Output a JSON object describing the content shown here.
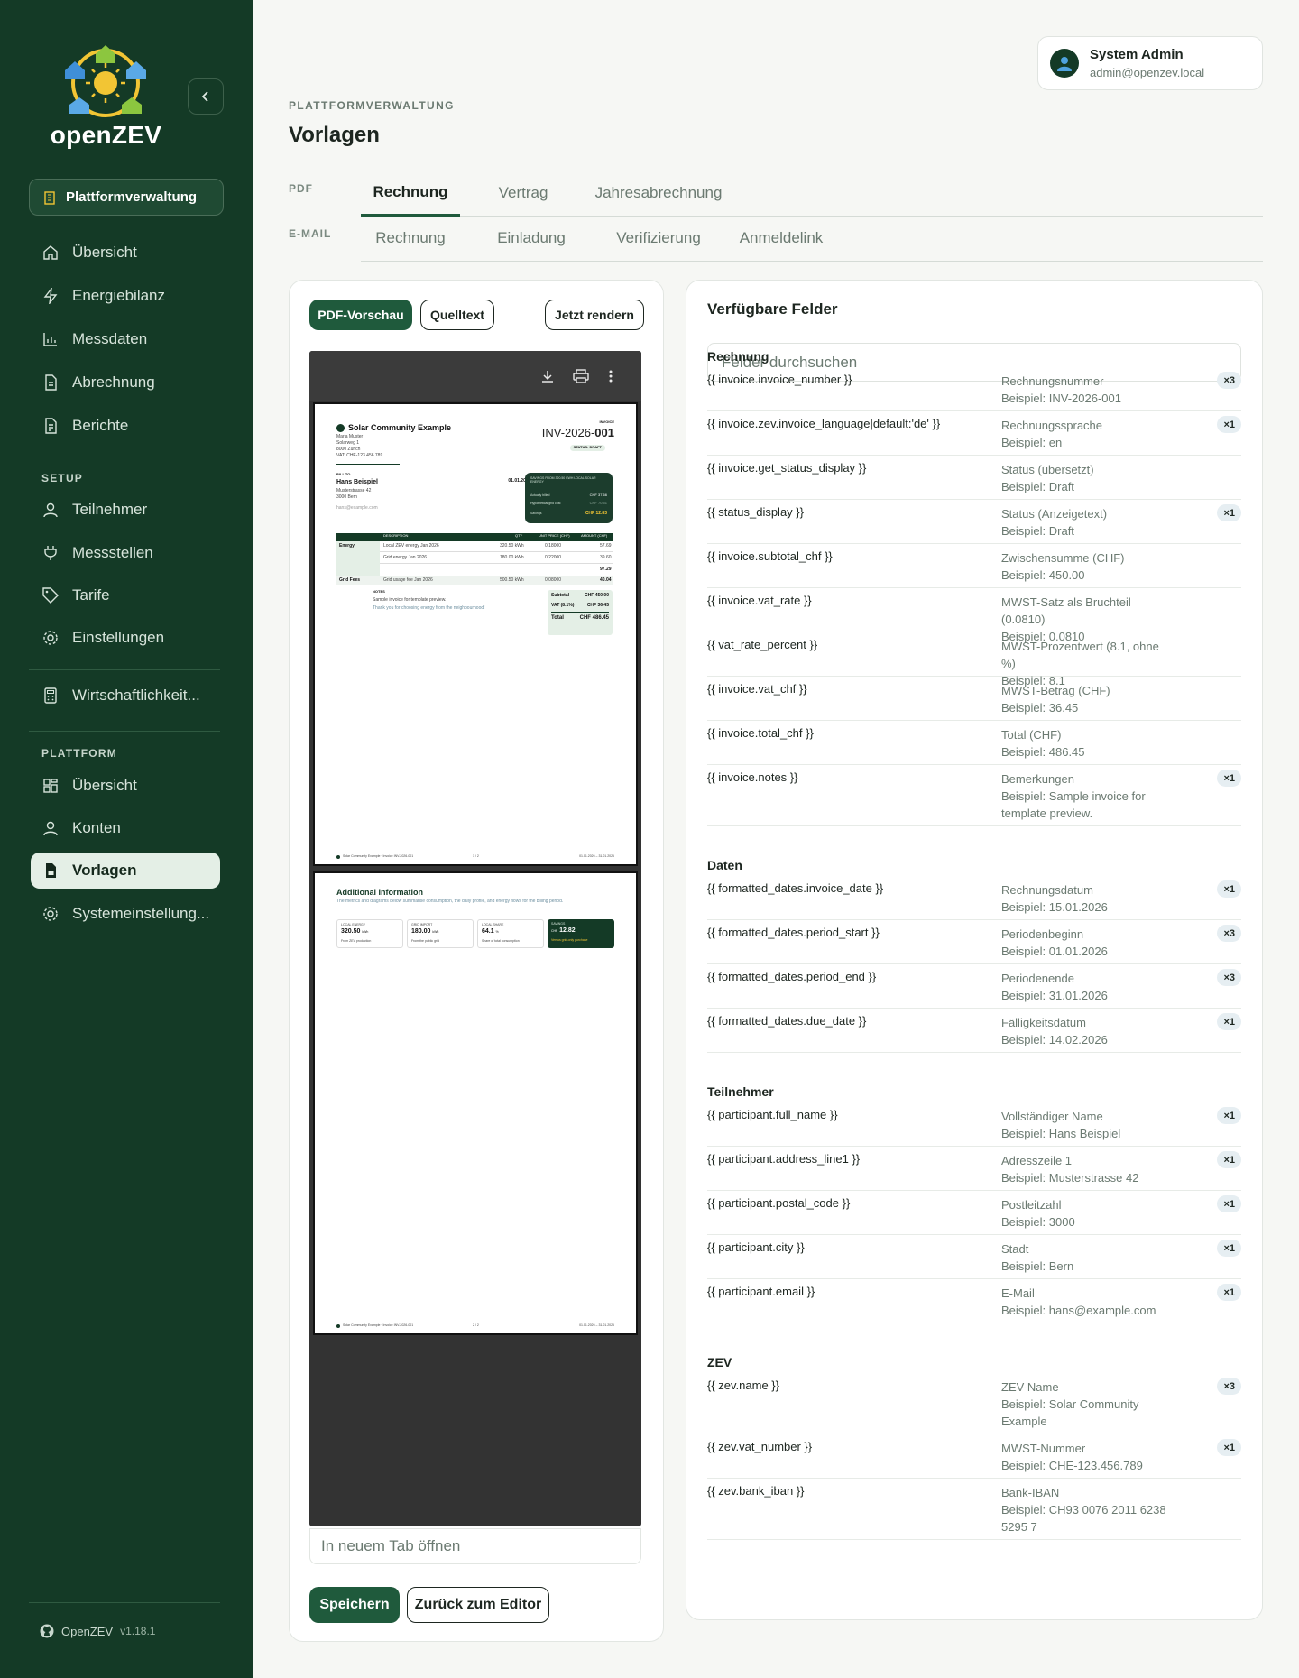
{
  "brand": {
    "name": "openZEV",
    "version_label": "OpenZEV",
    "version": "v1.18.1"
  },
  "sidebar": {
    "platform_button": "Plattformverwaltung",
    "main_items": [
      {
        "label": "Übersicht",
        "icon": "home-icon"
      },
      {
        "label": "Energiebilanz",
        "icon": "bolt-icon"
      },
      {
        "label": "Messdaten",
        "icon": "bar-chart-icon"
      },
      {
        "label": "Abrechnung",
        "icon": "document-icon"
      },
      {
        "label": "Berichte",
        "icon": "report-icon"
      }
    ],
    "setup_label": "SETUP",
    "setup_items": [
      {
        "label": "Teilnehmer",
        "icon": "user-icon"
      },
      {
        "label": "Messstellen",
        "icon": "plug-icon"
      },
      {
        "label": "Tarife",
        "icon": "tag-icon"
      },
      {
        "label": "Einstellungen",
        "icon": "gear-icon"
      }
    ],
    "extra_item": {
      "label": "Wirtschaftlichkeit...",
      "icon": "calculator-icon"
    },
    "platform_label": "PLATTFORM",
    "platform_items": [
      {
        "label": "Übersicht",
        "icon": "dashboard-icon"
      },
      {
        "label": "Konten",
        "icon": "user-icon"
      },
      {
        "label": "Vorlagen",
        "icon": "template-icon",
        "active": true
      },
      {
        "label": "Systemeinstellung...",
        "icon": "gear-icon"
      }
    ]
  },
  "user": {
    "name": "System Admin",
    "email": "admin@openzev.local"
  },
  "header": {
    "kicker": "PLATTFORMVERWALTUNG",
    "title": "Vorlagen"
  },
  "tabs": {
    "pdf_label": "PDF",
    "pdf": [
      "Rechnung",
      "Vertrag",
      "Jahresabrechnung"
    ],
    "email_label": "E-MAIL",
    "email": [
      "Rechnung",
      "Einladung",
      "Verifizierung",
      "Anmeldelink"
    ]
  },
  "preview": {
    "pdf_preview_btn": "PDF-Vorschau",
    "source_btn": "Quelltext",
    "render_btn": "Jetzt rendern",
    "open_new_tab": "In neuem Tab öffnen",
    "save_btn": "Speichern",
    "back_btn": "Zurück zum Editor",
    "doc": {
      "community": "Solar Community Example",
      "sender_lines": [
        "Maria Muster",
        "Solarweg 1",
        "8000 Zürich",
        "VAT: CHE-123.456.789"
      ],
      "invoice_label": "INVOICE",
      "invoice_prefix": "INV-2026-",
      "invoice_suffix": "001",
      "status": "STATUS: DRAFT",
      "bill_to": "BILL TO",
      "bill_name": "Hans Beispiel",
      "bill_lines": [
        "Musterstrasse 42",
        "3000 Bern",
        "hans@example.com"
      ],
      "billing_period_label": "BILLING PERIOD",
      "billing_period": "01.01.2026 – 31.01.2026",
      "invoice_date_label": "INVOICE DATE",
      "invoice_date": "15.01.2026",
      "due_date_label": "DUE DATE",
      "due_date": "14.02.2026",
      "savings_title": "SAVINGS FROM 320.50 KWH LOCAL SOLAR ENERGY",
      "savings_rows": [
        [
          "Actually billed",
          "CHF 37.66"
        ],
        [
          "Hypothetical grid cost",
          "CHF 70.51"
        ],
        [
          "Savings",
          "CHF 12.83"
        ]
      ],
      "table_headers": [
        "DESCRIPTION",
        "QTY",
        "UNIT PRICE (CHF)",
        "AMOUNT (CHF)"
      ],
      "energy_label": "Energy",
      "gridfees_label": "Grid Fees",
      "rows": [
        [
          "Local ZEV energy Jan 2026",
          "320.50 kWh",
          "0.18000",
          "57.69"
        ],
        [
          "Grid energy Jan 2026",
          "180.00 kWh",
          "0.22000",
          "39.60"
        ],
        [
          "",
          "",
          "",
          "97.29"
        ],
        [
          "Grid usage fee Jan 2026",
          "500.50 kWh",
          "0.08000",
          "40.04"
        ]
      ],
      "notes_label": "NOTES",
      "notes": "Sample invoice for template preview.",
      "thanks": "Thank you for choosing energy from the neighbourhood!",
      "totals": [
        [
          "Subtotal",
          "CHF 450.00"
        ],
        [
          "VAT (8.1%)",
          "CHF 36.45"
        ],
        [
          "Total",
          "CHF 486.45"
        ]
      ],
      "footer_left": "Solar Community Example · Invoice INV-2026-001",
      "footer_page1": "1 / 2",
      "footer_page2": "2 / 2",
      "footer_right": "01.01.2026 – 31.01.2026",
      "p2_title": "Additional Information",
      "p2_intro": "The metrics and diagrams below summarise consumption, the daily profile, and energy flows for the billing period.",
      "kpis": [
        {
          "label": "LOCAL ENERGY",
          "value": "320.50",
          "unit": "kWh",
          "sub": "From ZEV production"
        },
        {
          "label": "GRID IMPORT",
          "value": "180.00",
          "unit": "kWh",
          "sub": "From the public grid"
        },
        {
          "label": "LOCAL SHARE",
          "value": "64.1",
          "unit": "%",
          "sub": "Share of total consumption"
        },
        {
          "label": "SAVINGS",
          "value": "12.82",
          "unit": "CHF",
          "sub": "Versus grid-only purchase"
        }
      ]
    }
  },
  "fields": {
    "title": "Verfügbare Felder",
    "search_placeholder": "Felder durchsuchen",
    "groups": [
      {
        "name": "Rechnung",
        "items": [
          {
            "tag": "{{ invoice.invoice_number }}",
            "desc": "Rechnungsnummer",
            "example": "Beispiel: INV-2026-001",
            "count": "×3"
          },
          {
            "tag": "{{ invoice.zev.invoice_language|default:'de' }}",
            "desc": "Rechnungssprache",
            "example": "Beispiel: en",
            "count": "×1"
          },
          {
            "tag": "{{ invoice.get_status_display }}",
            "desc": "Status (übersetzt)",
            "example": "Beispiel: Draft",
            "count": ""
          },
          {
            "tag": "{{ status_display }}",
            "desc": "Status (Anzeigetext)",
            "example": "Beispiel: Draft",
            "count": "×1"
          },
          {
            "tag": "{{ invoice.subtotal_chf }}",
            "desc": "Zwischensumme (CHF)",
            "example": "Beispiel: 450.00",
            "count": ""
          },
          {
            "tag": "{{ invoice.vat_rate }}",
            "desc": "MWST-Satz als Bruchteil (0.0810)",
            "example": "Beispiel: 0.0810",
            "count": ""
          },
          {
            "tag": "{{ vat_rate_percent }}",
            "desc": "MWST-Prozentwert (8.1, ohne %)",
            "example": "Beispiel: 8.1",
            "count": ""
          },
          {
            "tag": "{{ invoice.vat_chf }}",
            "desc": "MWST-Betrag (CHF)",
            "example": "Beispiel: 36.45",
            "count": ""
          },
          {
            "tag": "{{ invoice.total_chf }}",
            "desc": "Total (CHF)",
            "example": "Beispiel: 486.45",
            "count": ""
          },
          {
            "tag": "{{ invoice.notes }}",
            "desc": "Bemerkungen",
            "example": "Beispiel: Sample invoice for template preview.",
            "count": "×1"
          }
        ]
      },
      {
        "name": "Daten",
        "items": [
          {
            "tag": "{{ formatted_dates.invoice_date }}",
            "desc": "Rechnungsdatum",
            "example": "Beispiel: 15.01.2026",
            "count": "×1"
          },
          {
            "tag": "{{ formatted_dates.period_start }}",
            "desc": "Periodenbeginn",
            "example": "Beispiel: 01.01.2026",
            "count": "×3"
          },
          {
            "tag": "{{ formatted_dates.period_end }}",
            "desc": "Periodenende",
            "example": "Beispiel: 31.01.2026",
            "count": "×3"
          },
          {
            "tag": "{{ formatted_dates.due_date }}",
            "desc": "Fälligkeitsdatum",
            "example": "Beispiel: 14.02.2026",
            "count": "×1"
          }
        ]
      },
      {
        "name": "Teilnehmer",
        "items": [
          {
            "tag": "{{ participant.full_name }}",
            "desc": "Vollständiger Name",
            "example": "Beispiel: Hans Beispiel",
            "count": "×1"
          },
          {
            "tag": "{{ participant.address_line1 }}",
            "desc": "Adresszeile 1",
            "example": "Beispiel: Musterstrasse 42",
            "count": "×1"
          },
          {
            "tag": "{{ participant.postal_code }}",
            "desc": "Postleitzahl",
            "example": "Beispiel: 3000",
            "count": "×1"
          },
          {
            "tag": "{{ participant.city }}",
            "desc": "Stadt",
            "example": "Beispiel: Bern",
            "count": "×1"
          },
          {
            "tag": "{{ participant.email }}",
            "desc": "E-Mail",
            "example": "Beispiel: hans@example.com",
            "count": "×1"
          }
        ]
      },
      {
        "name": "ZEV",
        "items": [
          {
            "tag": "{{ zev.name }}",
            "desc": "ZEV-Name",
            "example": "Beispiel: Solar Community Example",
            "count": "×3"
          },
          {
            "tag": "{{ zev.vat_number }}",
            "desc": "MWST-Nummer",
            "example": "Beispiel: CHE-123.456.789",
            "count": "×1"
          },
          {
            "tag": "{{ zev.bank_iban }}",
            "desc": "Bank-IBAN",
            "example": "Beispiel: CH93 0076 2011 6238 5295 7",
            "count": ""
          }
        ]
      }
    ]
  },
  "colors": {
    "sidebar": "#143a26",
    "accent": "#1f5a3c",
    "active_bg": "#e4efe6",
    "badge_bg": "#e6eef2"
  }
}
